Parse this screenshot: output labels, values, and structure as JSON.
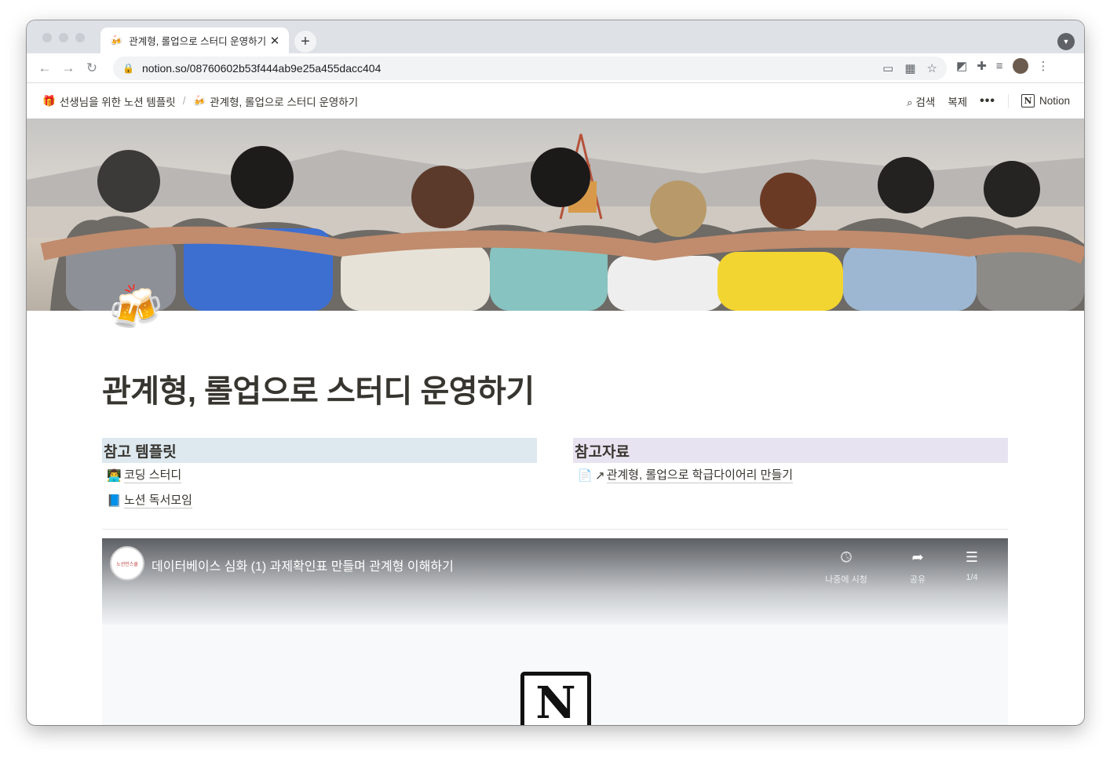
{
  "browser": {
    "tab_title": "관계형, 롤업으로 스터디 운영하기",
    "tab_favicon": "🍻",
    "url": "notion.so/08760602b53f444ab9e25a455dacc404",
    "close_glyph": "✕",
    "new_tab_glyph": "+"
  },
  "topbar": {
    "breadcrumb": [
      {
        "icon": "🎁",
        "label": "선생님을 위한 노션 템플릿"
      },
      {
        "icon": "🍻",
        "label": "관계형, 롤업으로 스터디 운영하기"
      }
    ],
    "separator": "/",
    "search_label": "검색",
    "duplicate_label": "복제",
    "more_glyph": "•••",
    "notion_label": "Notion"
  },
  "page": {
    "icon": "🍻",
    "title": "관계형, 롤업으로 스터디 운영하기",
    "left_column": {
      "heading": "참고 템플릿",
      "links": [
        {
          "icon": "👨‍💻",
          "label": "코딩 스터디"
        },
        {
          "icon": "📘",
          "label": "노션 독서모임"
        }
      ]
    },
    "right_column": {
      "heading": "참고자료",
      "links": [
        {
          "icon": "📄",
          "arrow": "↗",
          "label": "관계형, 롤업으로 학급다이어리 만들기"
        }
      ]
    }
  },
  "video": {
    "channel_logo_text": "노션인스쿨",
    "title": "데이터베이스 심화 (1) 과제확인표 만들며 관계형 이해하기",
    "watch_later_label": "나중에 시청",
    "share_label": "공유",
    "playlist_label": "1/4"
  },
  "colors": {
    "left_heading_bg": "#dde8ef",
    "right_heading_bg": "#e8e3f0",
    "text": "#37352f"
  }
}
